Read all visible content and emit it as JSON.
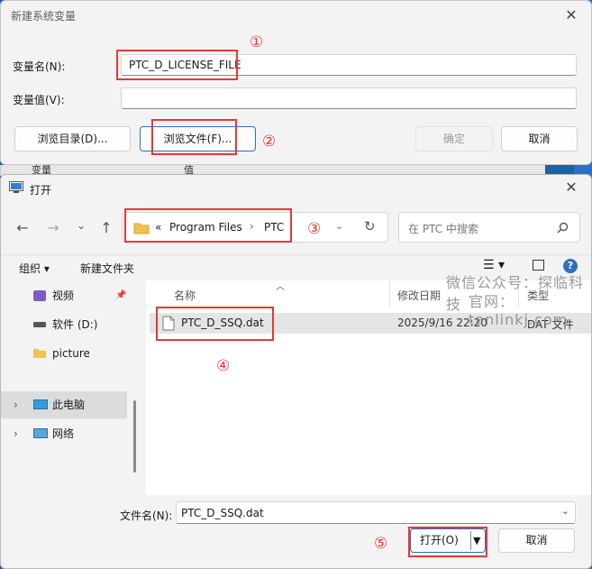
{
  "new_var_dialog": {
    "title": "新建系统变量",
    "name_label": "变量名(N):",
    "name_value": "PTC_D_LICENSE_FILE",
    "value_label": "变量值(V):",
    "value_value": "",
    "browse_dir": "浏览目录(D)...",
    "browse_file": "浏览文件(F)...",
    "ok": "确定",
    "cancel": "取消",
    "behind_col1": "变量",
    "behind_col2": "值"
  },
  "open_dialog": {
    "title": "打开",
    "breadcrumb_prefix": "«",
    "breadcrumb": [
      "Program Files",
      "PTC"
    ],
    "search_placeholder": "在 PTC 中搜索",
    "organize": "组织",
    "new_folder": "新建文件夹",
    "sidebar": [
      {
        "label": "视频",
        "icon": "video-folder-icon"
      },
      {
        "label": "软件 (D:)",
        "icon": "drive-icon"
      },
      {
        "label": "picture",
        "icon": "folder-icon"
      },
      {
        "label": "此电脑",
        "icon": "computer-icon"
      },
      {
        "label": "网络",
        "icon": "network-icon"
      }
    ],
    "columns": {
      "name": "名称",
      "modified": "修改日期",
      "type": "类型"
    },
    "files": [
      {
        "name": "PTC_D_SSQ.dat",
        "modified": "2025/9/16 22:20",
        "type": "DAT 文件"
      }
    ],
    "filename_label": "文件名(N):",
    "filename_value": "PTC_D_SSQ.dat",
    "open": "打开(O)",
    "cancel": "取消"
  },
  "annotations": [
    "①",
    "②",
    "③",
    "④",
    "⑤"
  ],
  "watermark": {
    "line1": "微信公众号：探临科技",
    "line2": "官网：tanlinkj.com"
  },
  "colors": {
    "highlight": "#e53935",
    "accent": "#2f6fbf",
    "folder": "#f2c14e"
  }
}
